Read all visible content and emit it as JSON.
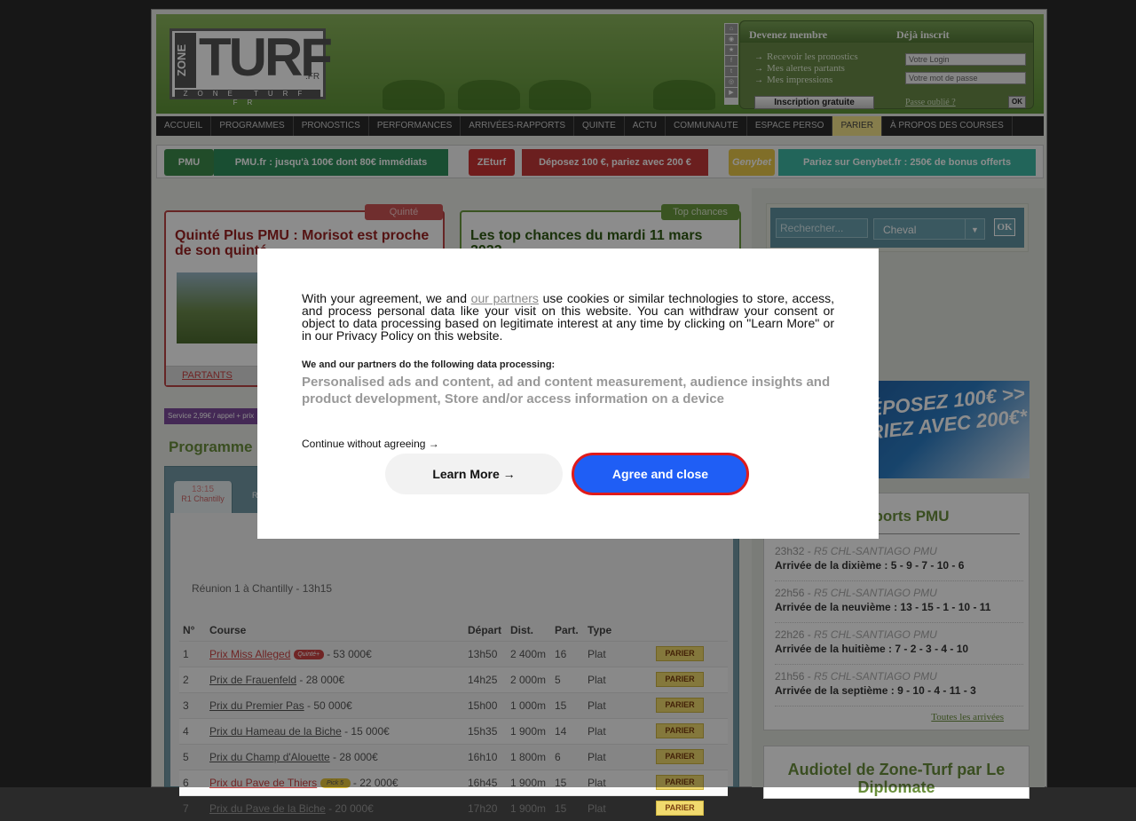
{
  "logo": {
    "zone": "ZONE",
    "turf": "TURF",
    "fr": ".FR",
    "sub": "ZONE TURF FR"
  },
  "member": {
    "become": "Devenez membre",
    "already": "Déjà inscrit",
    "links": [
      "Recevoir les pronostics",
      "Mes alertes partants",
      "Mes impressions"
    ],
    "signup": "Inscription gratuite",
    "login_placeholder": "Votre Login",
    "password_placeholder": "Votre mot de passe",
    "forgot": "Passe oublié ?",
    "ok": "OK"
  },
  "nav": [
    "ACCUEIL",
    "PROGRAMMES",
    "PRONOSTICS",
    "PERFORMANCES",
    "ARRIVÉES-RAPPORTS",
    "QUINTE",
    "ACTU",
    "COMMUNAUTE",
    "ESPACE PERSO",
    "PARIER",
    "À PROPOS DES COURSES"
  ],
  "promo": {
    "pmu_logo": "PMU",
    "pmu": "PMU.fr : jusqu'à 100€ dont 80€ immédiats",
    "zeturf_logo": "ZEturf",
    "zeturf": "Déposez 100 €, pariez avec 200 €",
    "genybet_logo": "Genybet",
    "genybet": "Pariez sur Genybet.fr : 250€ de bonus offerts"
  },
  "quinte": {
    "tag": "Quinté",
    "title": "Quinté Plus PMU : Morisot est proche de son quinté",
    "link": "PARTANTS"
  },
  "top": {
    "tag": "Top chances",
    "title": "Les top chances du mardi 11 mars 2023"
  },
  "service": "Service 2,99€ / appel + prix",
  "programme": {
    "title": "Programme",
    "tabs": [
      {
        "time": "13:15",
        "label": "R1 Chantilly"
      },
      {
        "time": "",
        "label": "R"
      }
    ],
    "reunion": "Réunion 1 à Chantilly - 13h15",
    "headers": [
      "N°",
      "Course",
      "Départ",
      "Dist.",
      "Part.",
      "Type",
      ""
    ],
    "rows": [
      {
        "n": "1",
        "name": "Prix Miss Alleged",
        "badge": "Quinté+",
        "prize": "- 53 000€",
        "dep": "13h50",
        "dist": "2 400m",
        "part": "16",
        "type": "Plat",
        "bet": "PARIER"
      },
      {
        "n": "2",
        "name": "Prix de Frauenfeld",
        "badge": "",
        "prize": "- 28 000€",
        "dep": "14h25",
        "dist": "2 000m",
        "part": "5",
        "type": "Plat",
        "bet": "PARIER"
      },
      {
        "n": "3",
        "name": "Prix du Premier Pas",
        "badge": "",
        "prize": "- 50 000€",
        "dep": "15h00",
        "dist": "1 000m",
        "part": "15",
        "type": "Plat",
        "bet": "PARIER"
      },
      {
        "n": "4",
        "name": "Prix du Hameau de la Biche",
        "badge": "",
        "prize": "- 15 000€",
        "dep": "15h35",
        "dist": "1 900m",
        "part": "14",
        "type": "Plat",
        "bet": "PARIER"
      },
      {
        "n": "5",
        "name": "Prix du Champ d'Alouette",
        "badge": "",
        "prize": "- 28 000€",
        "dep": "16h10",
        "dist": "1 800m",
        "part": "6",
        "type": "Plat",
        "bet": "PARIER"
      },
      {
        "n": "6",
        "name": "Prix du Pave de Thiers",
        "badge": "Pick 5",
        "prize": "- 22 000€",
        "dep": "16h45",
        "dist": "1 900m",
        "part": "15",
        "type": "Plat",
        "bet": "PARIER"
      },
      {
        "n": "7",
        "name": "Prix du Pave de la Biche",
        "badge": "",
        "prize": "- 20 000€",
        "dep": "17h20",
        "dist": "1 900m",
        "part": "15",
        "type": "Plat",
        "bet": "PARIER"
      }
    ]
  },
  "search": {
    "placeholder": "Rechercher...",
    "select": "Cheval",
    "ok": "OK"
  },
  "banner": {
    "line1": "DÉPOSEZ 100€ >>",
    "line2": "PARIEZ AVEC 200€*"
  },
  "arrivals": {
    "title": "...apports PMU",
    "items": [
      {
        "time": "23h32",
        "race": "R5 CHL-SANTIAGO PMU",
        "text": "Arrivée de la dixième : 5 - 9 - 7 - 10 - 6"
      },
      {
        "time": "22h56",
        "race": "R5 CHL-SANTIAGO PMU",
        "text": "Arrivée de la neuvième : 13 - 15 - 1 - 10 - 11"
      },
      {
        "time": "22h26",
        "race": "R5 CHL-SANTIAGO PMU",
        "text": "Arrivée de la huitième : 7 - 2 - 3 - 4 - 10"
      },
      {
        "time": "21h56",
        "race": "R5 CHL-SANTIAGO PMU",
        "text": "Arrivée de la septième : 9 - 10 - 4 - 11 - 3"
      }
    ],
    "all": "Toutes les arrivées"
  },
  "audiotel": "Audiotel de Zone-Turf par Le Diplomate",
  "consent": {
    "intro_a": "With your agreement, we and ",
    "partners": "our partners",
    "intro_b": " use cookies or similar technologies to store, access, and process personal data like your visit on this website. You can withdraw your consent or object to data processing based on legitimate interest at any time by clicking on \"Learn More\" or in our Privacy Policy on this website.",
    "processing_title": "We and our partners do the following data processing:",
    "purposes": "Personalised ads and content, ad and content measurement, audience insights and product development, Store and/or access information on a device",
    "continue": "Continue without agreeing →",
    "learn": "Learn More →",
    "agree": "Agree and close"
  }
}
